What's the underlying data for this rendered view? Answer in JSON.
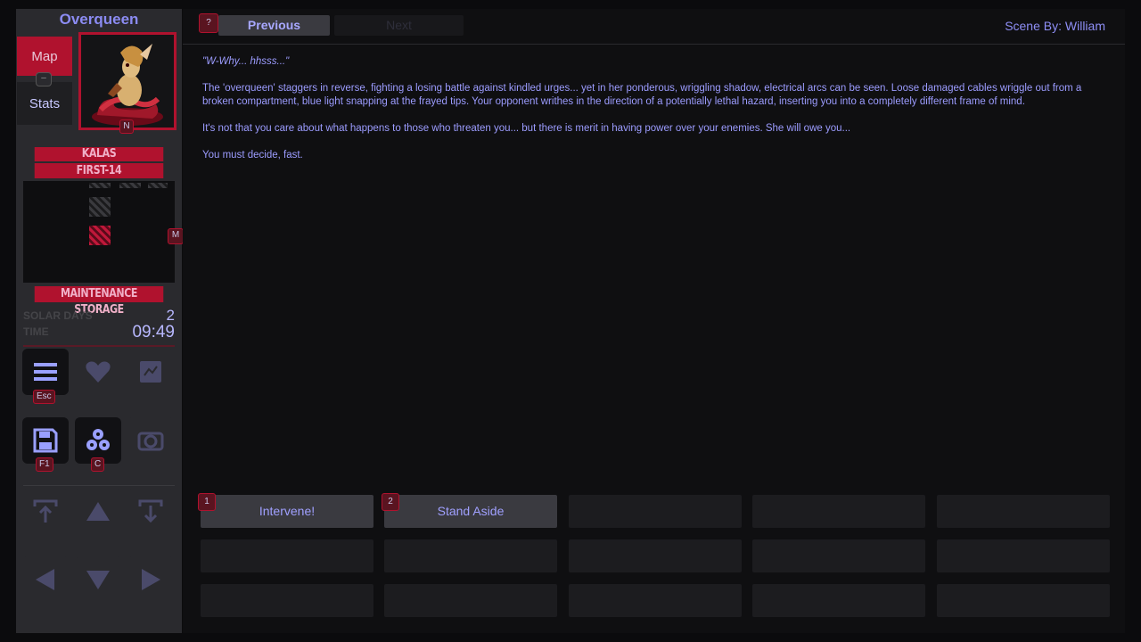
{
  "sidebar": {
    "character_name": "Overqueen",
    "tabs": {
      "map": "Map",
      "stats": "Stats",
      "dash": "–"
    },
    "portrait_key": "N",
    "location": {
      "zone": "KALAS",
      "area": "FIRST-14",
      "room": "MAINTENANCE STORAGE"
    },
    "map_key": "M",
    "solar_days_label": "SOLAR DAYS",
    "solar_days_value": "2",
    "time_label": "TIME",
    "time_value": "09:49",
    "keys": {
      "menu": "Esc",
      "save": "F1",
      "perks": "C"
    }
  },
  "header": {
    "help_key": "?",
    "previous_label": "Previous",
    "next_label": "Next",
    "scene_by": "Scene By: William"
  },
  "story": {
    "p1": "\"W-Why... hhsss...\"",
    "p2": "The 'overqueen' staggers in reverse, fighting a losing battle against kindled urges... yet in her ponderous, wriggling shadow, electrical arcs can be seen. Loose damaged cables wriggle out from a broken compartment, blue light snapping at the frayed tips. Your opponent writhes in the direction of a potentially lethal hazard, inserting you into a completely different frame of mind.",
    "p3": "It's not that you care about what happens to those who threaten you... but there is merit in having power over your enemies. She will owe you...",
    "p4": "You must decide, fast."
  },
  "choices": [
    {
      "key": "1",
      "label": "Intervene!"
    },
    {
      "key": "2",
      "label": "Stand Aside"
    }
  ],
  "colors": {
    "accent_red": "#b0122e",
    "text_blue": "#9c9cff",
    "panel_bg": "#0f0f11",
    "sidebar_bg": "#2a2a2e"
  },
  "icons": [
    "menu-icon",
    "heart-icon",
    "book-icon",
    "save-icon",
    "perks-icon",
    "camera-icon",
    "ascend-icon",
    "arrow-up-icon",
    "descend-icon",
    "arrow-left-icon",
    "arrow-down-icon",
    "arrow-right-icon"
  ]
}
